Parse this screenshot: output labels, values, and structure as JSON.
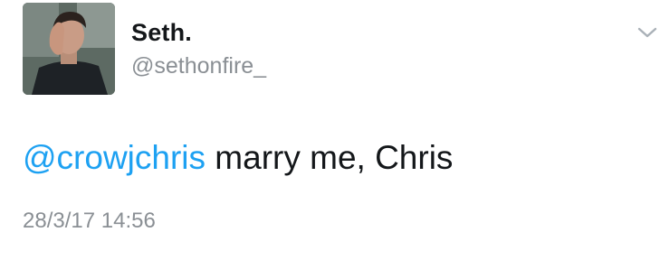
{
  "user": {
    "display_name": "Seth.",
    "handle": "@sethonfire_"
  },
  "tweet": {
    "mention": "@crowjchris",
    "body": " marry me, Chris",
    "timestamp": "28/3/17 14:56"
  },
  "icons": {
    "menu": "chevron-down-icon"
  },
  "colors": {
    "mention": "#1da1f2",
    "text": "#14171a",
    "secondary": "#8a8f94"
  }
}
